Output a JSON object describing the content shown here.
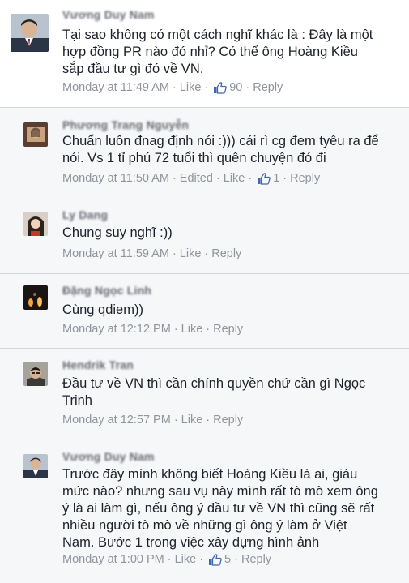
{
  "comments": [
    {
      "name": "Vương Duy Nam",
      "text": "Tại sao không có một cách nghĩ khác là : Đây là một\nhợp đồng PR nào đó nhỉ? Có thể ông Hoàng Kiều\nsắp đầu tư gì đó về VN.",
      "time": "Monday at 11:49 AM",
      "edited": "",
      "like_label": "Like",
      "like_count": "90",
      "reply_label": "Reply"
    },
    {
      "name": "Phương Trang Nguyễn",
      "text": "Chuẩn luôn đnag định nói :))) cái rì cg đem tyêu ra để\nnói. Vs 1 tỉ phú 72 tuổi thì quên chuyện đó đi",
      "time": "Monday at 11:50 AM",
      "edited": "Edited",
      "like_label": "Like",
      "like_count": "1",
      "reply_label": "Reply"
    },
    {
      "name": "Ly Dang",
      "text": "Chung suy nghĩ :))",
      "time": "Monday at 11:59 AM",
      "edited": "",
      "like_label": "Like",
      "like_count": "",
      "reply_label": "Reply"
    },
    {
      "name": "Đặng Ngọc Linh",
      "text": "Cùng qdiem))",
      "time": "Monday at 12:12 PM",
      "edited": "",
      "like_label": "Like",
      "like_count": "",
      "reply_label": "Reply"
    },
    {
      "name": "Hendrik Tran",
      "text": "Đầu tư về VN thì cần chính quyền chứ cần gì Ngọc\nTrinh",
      "time": "Monday at 12:57 PM",
      "edited": "",
      "like_label": "Like",
      "like_count": "",
      "reply_label": "Reply"
    },
    {
      "name": "Vương Duy Nam",
      "text": "Trước đây mình không biết Hoàng Kiều là ai, giàu\nmức nào? nhưng sau vụ này mình rất tò mò xem ông\ný là ai làm gì, nếu ông ý đầu tư về VN thì cũng sẽ rất\nnhiều người tò mò về những gì ông ý làm ở Việt\nNam. Bước 1 trong việc xây dựng hình ảnh",
      "time": "Monday at 1:00 PM",
      "edited": "",
      "like_label": "Like",
      "like_count": "5",
      "reply_label": "Reply"
    }
  ],
  "colors": {
    "text": "#1d2129",
    "meta": "#90949c",
    "reply_bg": "#f6f7f9",
    "like_blue": "#4267b2"
  }
}
